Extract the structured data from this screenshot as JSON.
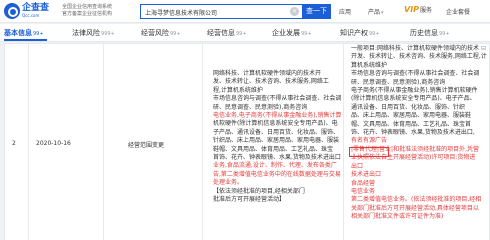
{
  "header": {
    "logo_name": "企查查",
    "logo_sub": "Qcc.com",
    "slogan_line1": "全国企业信用查询系统",
    "slogan_line2": "官方备案企业征信机构",
    "search_value": "上海寻梦信息技术有限公司",
    "search_clear_icon": "×",
    "search_button": "查一下",
    "nav_app": "应用",
    "nav_products": "产品",
    "vip_label": "VIP",
    "vip_sub": "服务",
    "nav_enterprise": "企业套餐"
  },
  "tabs": [
    {
      "label": "基本信息",
      "count": "99+",
      "active": true
    },
    {
      "label": "法律风险",
      "count": "999+"
    },
    {
      "label": "经营风险",
      "count": "99+"
    },
    {
      "label": "经营信息",
      "count": "99+"
    },
    {
      "label": "企业发展",
      "count": "99+"
    },
    {
      "label": "知识产权",
      "count": "99+"
    },
    {
      "label": "历史信息",
      "count": "99+"
    }
  ],
  "row": {
    "index": "2",
    "date": "2020-10-16",
    "item": "经营范围变更",
    "before_lines": [
      "网络科技、计算机软硬件领域内的技术开",
      "发、技术转让、技术咨询、技术服务,网络工",
      "程,计算机系统维护",
      "市场信息咨询与调查(不得从事社会调查、社会调",
      "研、民意调查、民意测验),商务咨询",
      "电信业务,电子商务(不得从事金融业务),销售计算",
      "机软硬件(除计算机信息系统安全专用产品)、电",
      "子产品、通讯设备、日用百货、化妆品、服饰、",
      "针织品、床上用品、家居用品、家用电器、服装",
      "鞋帽、文具用品、体育用品、工艺礼品、珠宝",
      "首饰、花卉、钟表眼镜、水果,货物及技术进出口",
      "业务,食品流通,设计、制作、代理、发布各类广",
      "告,第二类增值电信业务中的在线数据处理与交易",
      "处理业务。",
      "【依法须经批准的项目,经相关部门",
      "批准后方可开展经营活动】"
    ],
    "after_lines": [
      "一般项目:网络科技、计算机软硬件领域内的技术",
      "开发、技术转让、技术咨询、技术服务,网络工程,计",
      "算机系统维护",
      "市场信息咨询与调查(不得从事社会调查、社会调",
      "研、民意调查、民意测验),商务咨询",
      "电子商务(不得从事金融业务),销售计算机软硬件",
      "(除计算机信息系统安全专用产品)、电子产品、",
      "通讯设备、日用百货、化妆品、服饰、针织",
      "品、床上用品、家居用品、家用电器、服装鞋",
      "帽、文具用品、体育用品、工艺礼品、珠宝首",
      "饰、花卉、钟表眼镜、水果,货物及技术进出口,",
      "有名有源广告",
      "|零售代理|营业|和批准法须经批准的项目外,凭营",
      "业执照依法自主开展经营活动)许可项目:货物进",
      "出口",
      "技术进出口",
      "食品经营",
      "电信业务",
      "第二类增值电信业务。(依法须经批准的项目,经相",
      "关部门批准后方可开展经营活动,具体经营项目以",
      "相关部门批准文件或许可证件为准)"
    ],
    "pin_icon": "⊟"
  }
}
